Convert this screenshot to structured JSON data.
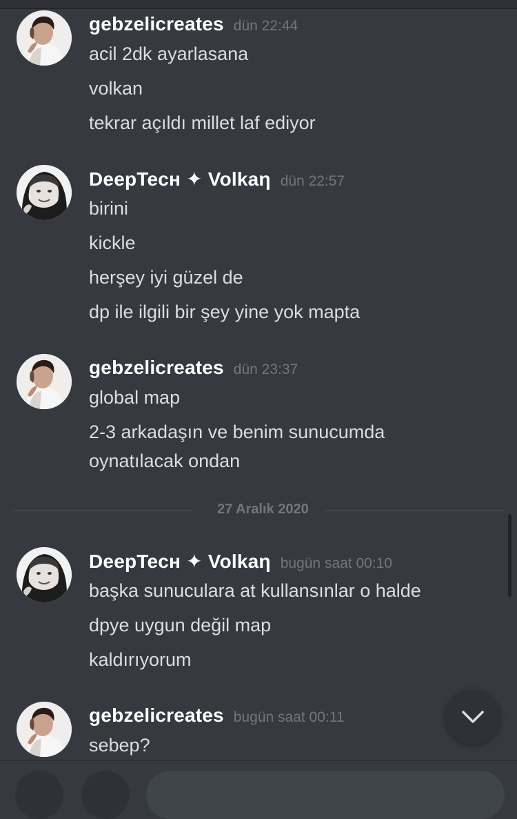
{
  "messages": [
    {
      "author": "gebzelicreates",
      "time": "dün 22:44",
      "lines": [
        "acil 2dk ayarlasana",
        "volkan",
        "tekrar açıldı millet laf ediyor"
      ]
    },
    {
      "author": "DeepTecн ✦ Volkaη",
      "time": "dün 22:57",
      "lines": [
        "birini",
        "kickle",
        "herşey iyi güzel de",
        "dp ile ilgili bir şey yine yok mapta"
      ]
    },
    {
      "author": "gebzelicreates",
      "time": "dün 23:37",
      "lines": [
        "global map",
        "2-3 arkadaşın ve benim sunucumda",
        "oynatılacak ondan"
      ]
    },
    {
      "author": "DeepTecн ✦ Volkaη",
      "time": "bugün saat 00:10",
      "lines": [
        "başka sunuculara at kullansınlar o halde",
        "dpye uygun değil map",
        "kaldırıyorum"
      ]
    },
    {
      "author": "gebzelicreates",
      "time": "bugün saat 00:11",
      "lines": [
        "sebep?"
      ]
    }
  ],
  "date_divider": "27 Aralık 2020",
  "icons": {
    "jump_to_bottom": "chevron-down-icon"
  },
  "colors": {
    "background": "#36393f",
    "username": "#ffffff",
    "text": "#dcddde",
    "muted": "#72767d"
  }
}
